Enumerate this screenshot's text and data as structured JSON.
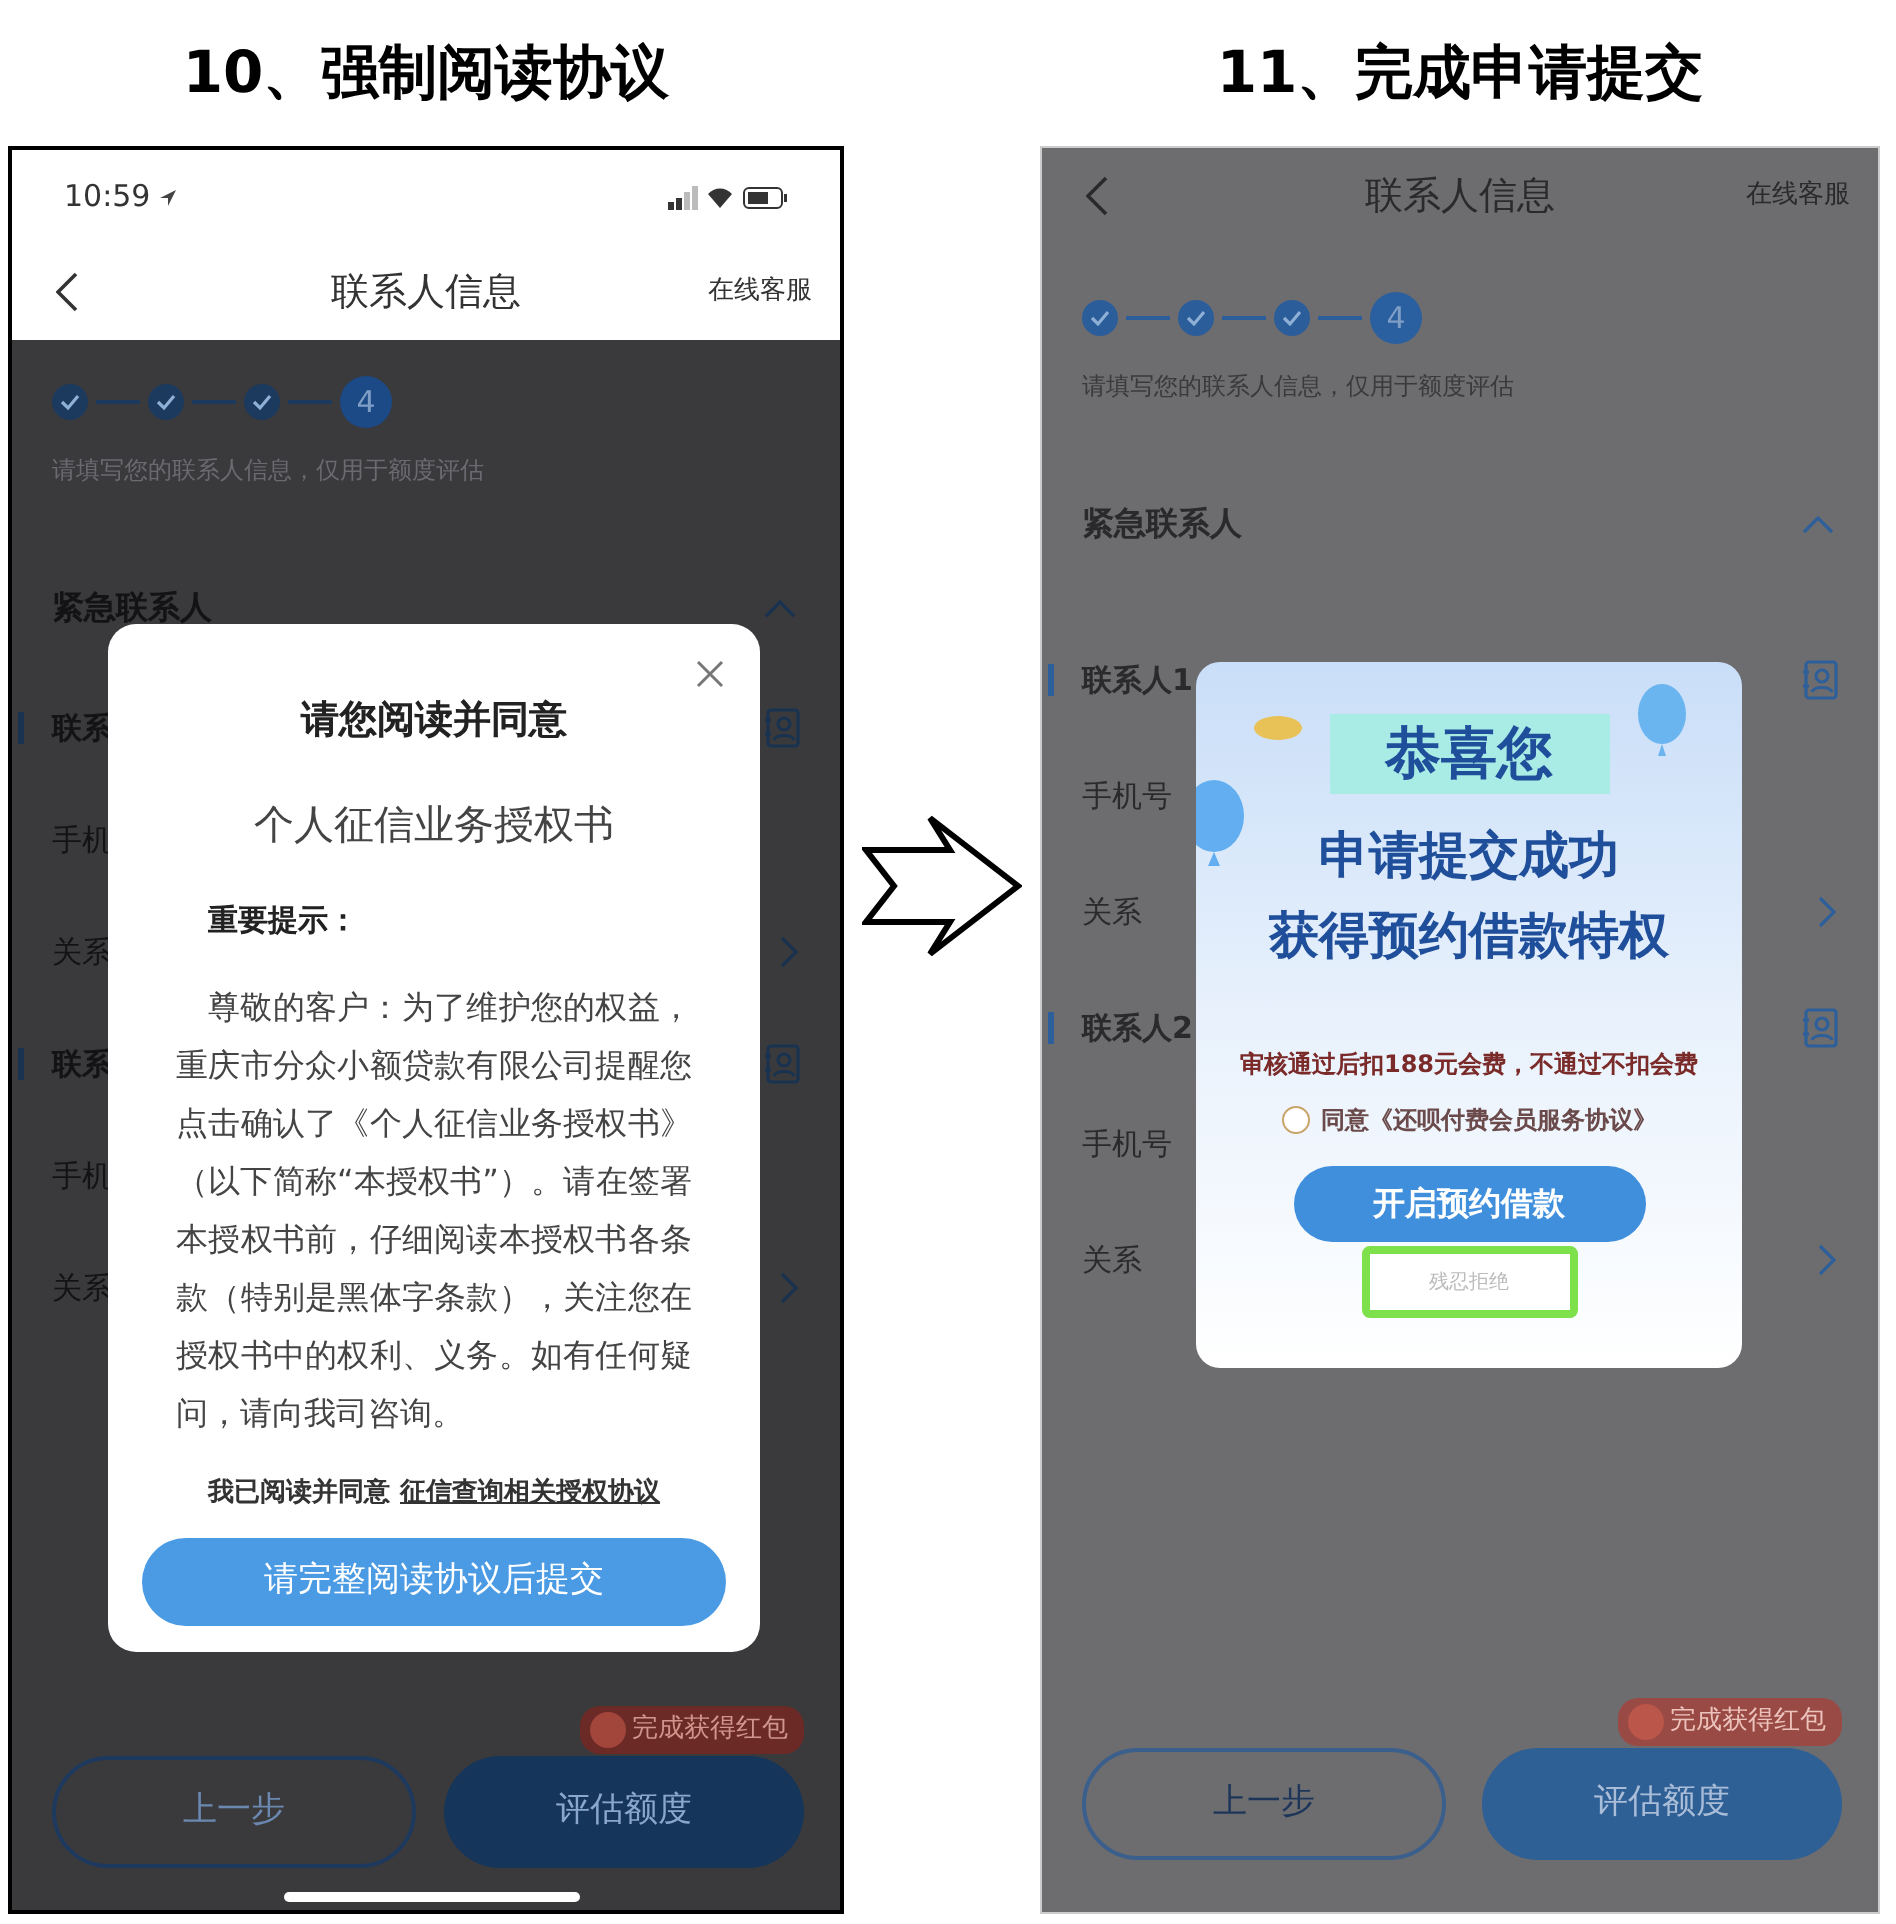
{
  "screens": [
    {
      "caption": "10、强制阅读协议",
      "status_bar": {
        "time": "10:59"
      },
      "nav": {
        "title": "联系人信息",
        "action": "在线客服"
      },
      "steps": [
        {
          "done": true
        },
        {
          "done": true
        },
        {
          "done": true
        },
        {
          "done": false,
          "number": "4"
        }
      ],
      "hint": "请填写您的联系人信息，仅用于额度评估",
      "section": {
        "title": "紧急联系人",
        "expanded": true
      },
      "rows": [
        {
          "label": "联系",
          "kind": "contact"
        },
        {
          "label": "手机",
          "kind": "field"
        },
        {
          "label": "关系",
          "kind": "select"
        },
        {
          "label": "联系",
          "kind": "contact"
        },
        {
          "label": "手机",
          "kind": "field"
        },
        {
          "label": "关系",
          "kind": "select"
        }
      ],
      "footer": {
        "back": "上一步",
        "next": "评估额度",
        "badge": "完成获得红包"
      },
      "dialog": {
        "kind": "agreement",
        "title": "请您阅读并同意",
        "doc_title": "个人征信业务授权书",
        "notice_heading": "重要提示：",
        "body": "尊敬的客户：为了维护您的权益，重庆市分众小额贷款有限公司提醒您点击确认了《个人征信业务授权书》（以下简称“本授权书”）。请在签署本授权书前，仔细阅读本授权书各条款（特别是黑体字条款），关注您在授权书中的权利、义务。如有任何疑问，请向我司咨询。",
        "consent": "我已阅读并同意",
        "consent_link": "征信查询相关授权协议",
        "submit": "请完整阅读协议后提交"
      }
    },
    {
      "caption": "11、完成申请提交",
      "nav": {
        "title": "联系人信息",
        "action": "在线客服"
      },
      "steps": [
        {
          "done": true
        },
        {
          "done": true
        },
        {
          "done": true
        },
        {
          "done": false,
          "number": "4"
        }
      ],
      "hint": "请填写您的联系人信息，仅用于额度评估",
      "section": {
        "title": "紧急联系人",
        "expanded": true
      },
      "rows": [
        {
          "label": "联系人1",
          "kind": "contact"
        },
        {
          "label": "手机号",
          "kind": "field"
        },
        {
          "label": "关系",
          "kind": "select"
        },
        {
          "label": "联系人2",
          "kind": "contact"
        },
        {
          "label": "手机号",
          "kind": "field"
        },
        {
          "label": "关系",
          "kind": "select"
        }
      ],
      "footer": {
        "back": "上一步",
        "next": "评估额度",
        "badge": "完成获得红包"
      },
      "dialog": {
        "kind": "success",
        "title": "恭喜您",
        "headline": [
          "申请提交成功",
          "获得预约借款特权"
        ],
        "fee": "审核通过后扣188元会费，不通过不扣会费",
        "agree": {
          "checked": false,
          "label": "同意《还呗付费会员服务协议》"
        },
        "primary": "开启预约借款",
        "decline": {
          "label": "残忍拒绝",
          "highlighted": true
        }
      }
    }
  ]
}
